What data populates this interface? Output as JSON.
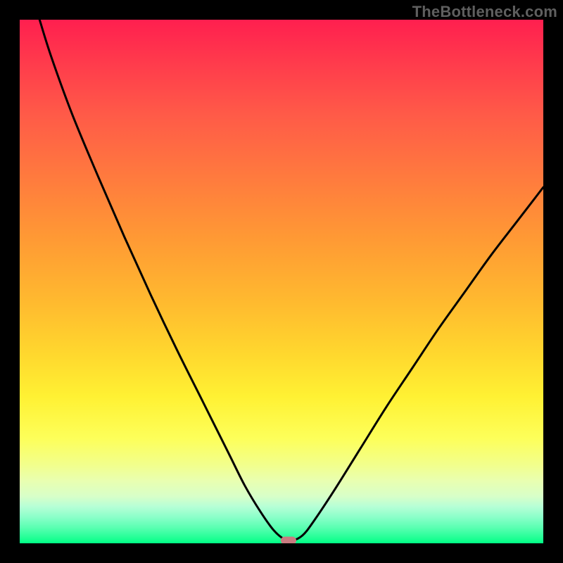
{
  "watermark": "TheBottleneck.com",
  "chart_data": {
    "type": "line",
    "title": "",
    "xlabel": "",
    "ylabel": "",
    "xlim": [
      0,
      100
    ],
    "ylim": [
      0,
      100
    ],
    "grid": false,
    "legend": false,
    "background": "rainbow-gradient-vertical",
    "gradient_stops": [
      {
        "pos": 0,
        "color": "#ff1f4f"
      },
      {
        "pos": 18,
        "color": "#ff5a48"
      },
      {
        "pos": 42,
        "color": "#ff9a34"
      },
      {
        "pos": 64,
        "color": "#ffd82e"
      },
      {
        "pos": 80,
        "color": "#fdff5a"
      },
      {
        "pos": 91,
        "color": "#d8ffc8"
      },
      {
        "pos": 100,
        "color": "#00ff85"
      }
    ],
    "series": [
      {
        "name": "bottleneck-curve",
        "color": "#000000",
        "stroke_width": 3,
        "x": [
          3.8,
          6,
          10,
          15,
          20,
          25,
          30,
          35,
          40,
          43,
          46,
          48.5,
          50.5,
          52,
          54,
          56,
          60,
          65,
          70,
          75,
          80,
          85,
          90,
          95,
          100
        ],
        "y": [
          100,
          93,
          82,
          70,
          58.5,
          47.5,
          37,
          27,
          17,
          11,
          6,
          2.5,
          0.8,
          0.5,
          1.5,
          4,
          10,
          18,
          26,
          33.5,
          41,
          48,
          55,
          61.5,
          68
        ]
      }
    ],
    "marker": {
      "name": "optimal-point",
      "x": 51.3,
      "y": 0.5,
      "color": "#c97b80",
      "shape": "pill"
    }
  }
}
